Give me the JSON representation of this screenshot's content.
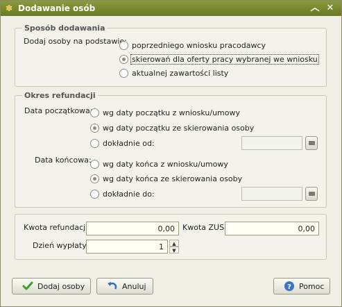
{
  "window": {
    "title": "Dodawanie osób"
  },
  "sposob": {
    "title": "Sposób dodawania",
    "label": "Dodaj osoby na podstawie:",
    "options": [
      {
        "label": "poprzedniego wniosku pracodawcy",
        "checked": false
      },
      {
        "label": "skierowań dla oferty pracy wybranej we wniosku",
        "checked": true
      },
      {
        "label": "aktualnej zawartości listy",
        "checked": false
      }
    ]
  },
  "okres": {
    "title": "Okres refundacji",
    "start_label": "Data początkowa:",
    "start_options": [
      {
        "label": "wg daty początku z wniosku/umowy",
        "checked": false
      },
      {
        "label": "wg daty początku ze skierowania osoby",
        "checked": true
      },
      {
        "label": "dokładnie od:",
        "checked": false
      }
    ],
    "end_label": "Data końcowa:",
    "end_options": [
      {
        "label": "wg daty końca z wniosku/umowy",
        "checked": false
      },
      {
        "label": "wg daty końca ze skierowania osoby",
        "checked": true
      },
      {
        "label": "dokładnie do:",
        "checked": false
      }
    ]
  },
  "kwoty": {
    "refund_label": "Kwota refundacji:",
    "refund_value": "0,00",
    "zus_label": "Kwota ZUS:",
    "zus_value": "0,00",
    "day_label": "Dzień wypłaty:",
    "day_value": "1"
  },
  "buttons": {
    "add": "Dodaj osoby",
    "cancel": "Anuluj",
    "help": "Pomoc"
  }
}
